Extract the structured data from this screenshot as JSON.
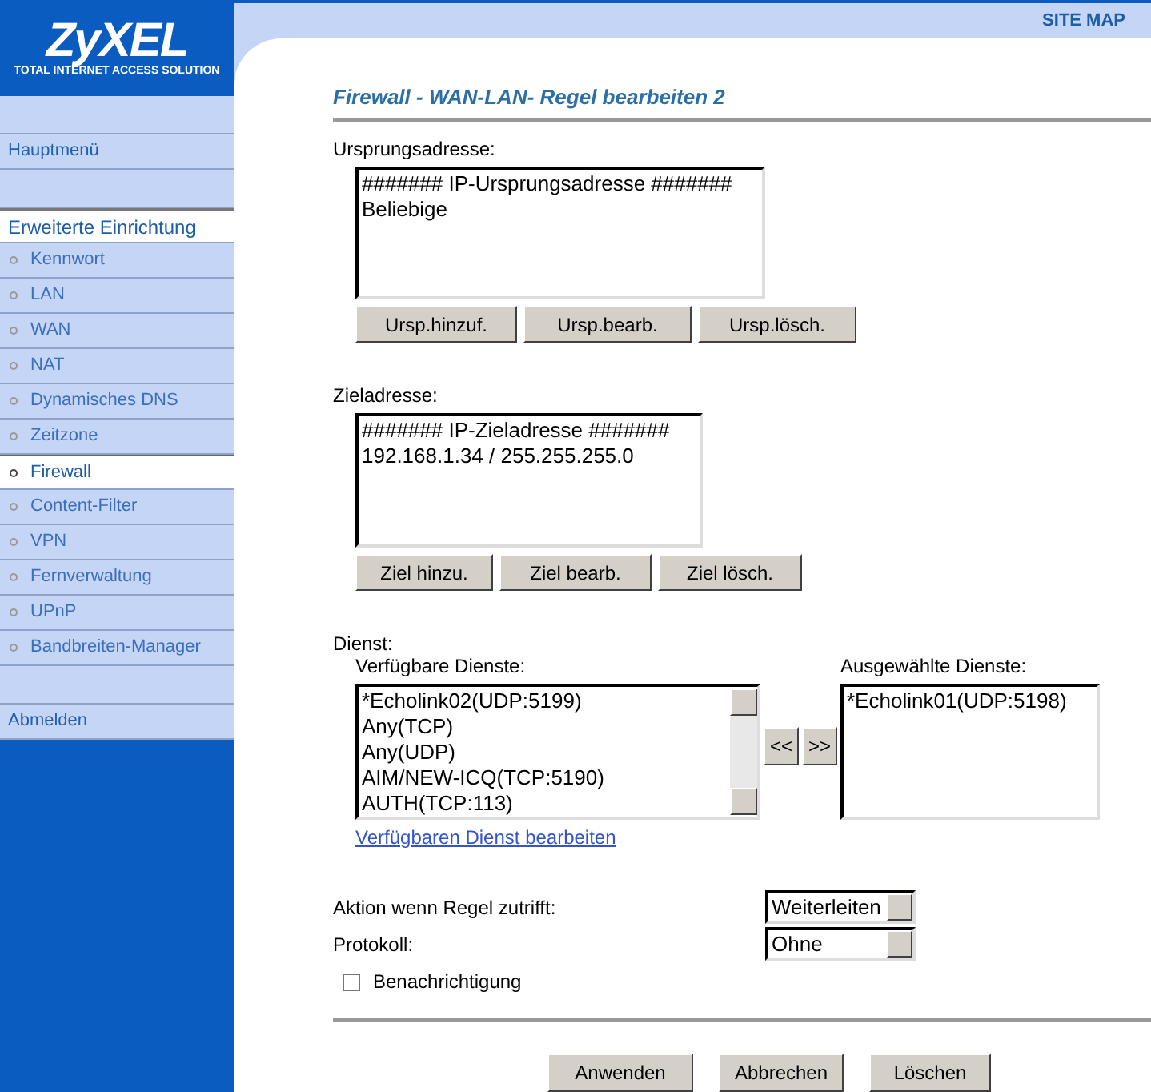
{
  "logo": {
    "name": "ZyXEL",
    "tagline": "TOTAL INTERNET ACCESS SOLUTION"
  },
  "header": {
    "site_map": "SITE MAP"
  },
  "sidebar": {
    "main_menu": "Hauptmenü",
    "section": {
      "title": "Erweiterte Einrichtung",
      "items": [
        {
          "label": "Kennwort",
          "selected": false
        },
        {
          "label": "LAN",
          "selected": false
        },
        {
          "label": "WAN",
          "selected": false
        },
        {
          "label": "NAT",
          "selected": false
        },
        {
          "label": "Dynamisches DNS",
          "selected": false
        },
        {
          "label": "Zeitzone",
          "selected": false
        },
        {
          "label": "Firewall",
          "selected": true
        },
        {
          "label": "Content-Filter",
          "selected": false
        },
        {
          "label": "VPN",
          "selected": false
        },
        {
          "label": "Fernverwaltung",
          "selected": false
        },
        {
          "label": "UPnP",
          "selected": false
        },
        {
          "label": "Bandbreiten-Manager",
          "selected": false
        }
      ]
    },
    "logout": "Abmelden"
  },
  "title": "Firewall - WAN-LAN- Regel bearbeiten 2",
  "source": {
    "label": "Ursprungsadresse:",
    "items": [
      "####### IP-Ursprungsadresse #######",
      "Beliebige"
    ],
    "buttons": [
      "Ursp.hinzuf.",
      "Ursp.bearb.",
      "Ursp.lösch."
    ]
  },
  "destination": {
    "label": "Zieladresse:",
    "items": [
      "####### IP-Zieladresse #######",
      "192.168.1.34 / 255.255.255.0"
    ],
    "buttons": [
      "Ziel hinzu.",
      "Ziel bearb.",
      "Ziel lösch."
    ]
  },
  "service": {
    "label": "Dienst:",
    "available": {
      "label": "Verfügbare Dienste:",
      "items": [
        "*Echolink02(UDP:5199)",
        "Any(TCP)",
        "Any(UDP)",
        "AIM/NEW-ICQ(TCP:5190)",
        "AUTH(TCP:113)"
      ]
    },
    "move_buttons": [
      "<<",
      ">>"
    ],
    "chosen": {
      "label": "Ausgewählte Dienste:",
      "items": [
        "*Echolink01(UDP:5198)"
      ]
    },
    "edit_link": "Verfügbaren Dienst bearbeiten"
  },
  "action": {
    "label": "Aktion wenn Regel zutrifft:",
    "value": "Weiterleiten"
  },
  "protocol": {
    "label": "Protokoll:",
    "value": "Ohne"
  },
  "notify": {
    "label": "Benachrichtigung",
    "checked": false
  },
  "buttons": [
    "Anwenden",
    "Abbrechen",
    "Löschen"
  ]
}
